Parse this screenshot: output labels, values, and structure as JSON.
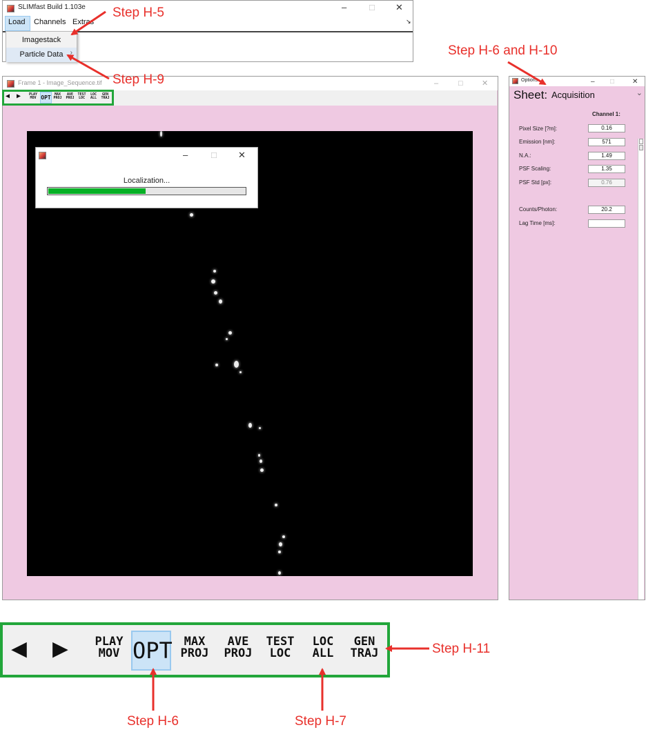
{
  "app_window": {
    "title": "SLIMfast Build 1.103e",
    "minimize": "–",
    "maximize": "□",
    "close": "✕",
    "menus": [
      "Load",
      "Channels",
      "Extras"
    ],
    "corner_glyph": "↘",
    "load_dropdown": [
      "Imagestack",
      "Particle Data"
    ],
    "submenu_arrow": "›"
  },
  "frame_window": {
    "title": "Frame 1 - Image_Sequence.tif",
    "minimize": "–",
    "maximize": "□",
    "close": "✕",
    "toolbar": [
      {
        "top": "◀",
        "bottom": ""
      },
      {
        "top": "▶",
        "bottom": ""
      },
      {
        "top": "PLAY",
        "bottom": "MOV"
      },
      {
        "top": "OPT",
        "bottom": ""
      },
      {
        "top": "MAX",
        "bottom": "PROJ"
      },
      {
        "top": "AVE",
        "bottom": "PROJ"
      },
      {
        "top": "TEST",
        "bottom": "LOC"
      },
      {
        "top": "LOC",
        "bottom": "ALL"
      },
      {
        "top": "GEN",
        "bottom": "TRAJ"
      }
    ]
  },
  "progress_dialog": {
    "minimize": "–",
    "maximize": "□",
    "close": "✕",
    "message": "Localization...",
    "progress": 0.49
  },
  "options_window": {
    "title": "Options",
    "minimize": "–",
    "maximize": "□",
    "close": "✕",
    "sheet_label": "Sheet:",
    "sheet_value": "Acquisition",
    "dropdown_arrow": "⌄",
    "channel_header": "Channel 1:",
    "fields": [
      {
        "label": "Pixel Size [?m]:",
        "value": "0.16"
      },
      {
        "label": "Emission [nm]:",
        "value": "571"
      },
      {
        "label": "N.A.:",
        "value": "1.49"
      },
      {
        "label": "PSF Scaling:",
        "value": "1.35"
      },
      {
        "label": "PSF Std [px]:",
        "value": "0.76"
      },
      {
        "label": "Counts/Photon:",
        "value": "20.2"
      },
      {
        "label": "Lag Time [ms]:",
        "value": ""
      }
    ]
  },
  "annotations": {
    "step_h5": "Step H-5",
    "step_h6_h10": "Step H-6 and H-10",
    "step_h9": "Step H-9",
    "step_h11": "Step H-11",
    "step_h6": "Step H-6",
    "step_h7": "Step H-7"
  },
  "colors": {
    "annotation_red": "#e8302b",
    "highlight_green": "#22a63a",
    "panel_pink": "#efc9e2",
    "progress_green": "#06b025",
    "selected_blue": "#cce4f7"
  }
}
